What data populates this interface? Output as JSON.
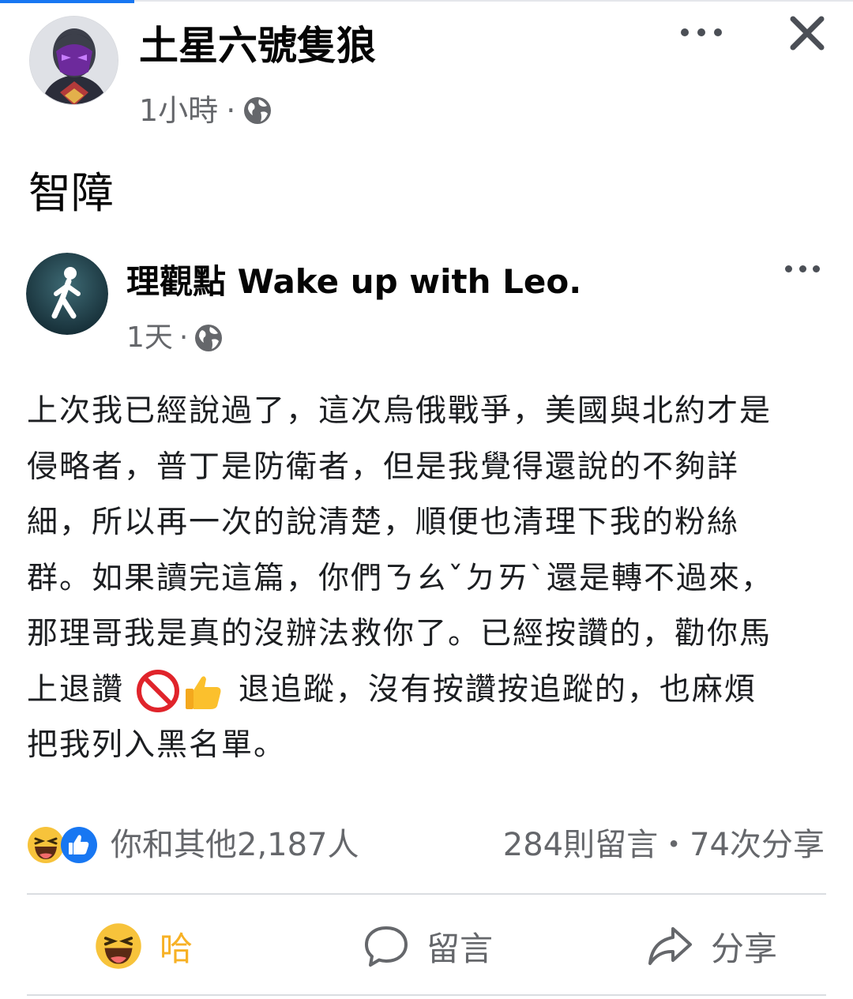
{
  "post": {
    "author": "土星六號隻狼",
    "time": "1小時",
    "separator": "·",
    "text": "智障",
    "avatar_icon": "masked-character-avatar",
    "privacy_icon": "globe-icon"
  },
  "shared": {
    "author": "理觀點 Wake up with Leo.",
    "time": "1天",
    "separator": "·",
    "avatar_icon": "walking-person-logo",
    "lines": [
      "上次我已經說過了，這次烏俄戰爭，美國與北約才是",
      "侵略者，普丁是防衛者，但是我覺得還說的不夠詳",
      "細，所以再一次的說清楚，順便也清理下我的粉絲",
      "群。如果讀完這篇，你們ㄋㄠˇㄉㄞˋ還是轉不過來，",
      "那理哥我是真的沒辦法救你了。已經按讚的，勸你馬"
    ],
    "line6_before": "上退讚",
    "line6_after": " 退追蹤，沒有按讚按追蹤的，也麻煩",
    "line7": "把我列入黑名單。",
    "line6_emojis": [
      "no-entry-icon",
      "thumbs-up-icon"
    ]
  },
  "reactions": {
    "text": "你和其他2,187人",
    "icons": [
      "haha-icon",
      "like-icon"
    ],
    "comments_shares": "284則留言・74次分享"
  },
  "actions": {
    "haha": "哈",
    "comment": "留言",
    "share": "分享"
  },
  "colors": {
    "accent": "#1877f2",
    "haha": "#f7b125",
    "secondary_text": "#65676b"
  }
}
